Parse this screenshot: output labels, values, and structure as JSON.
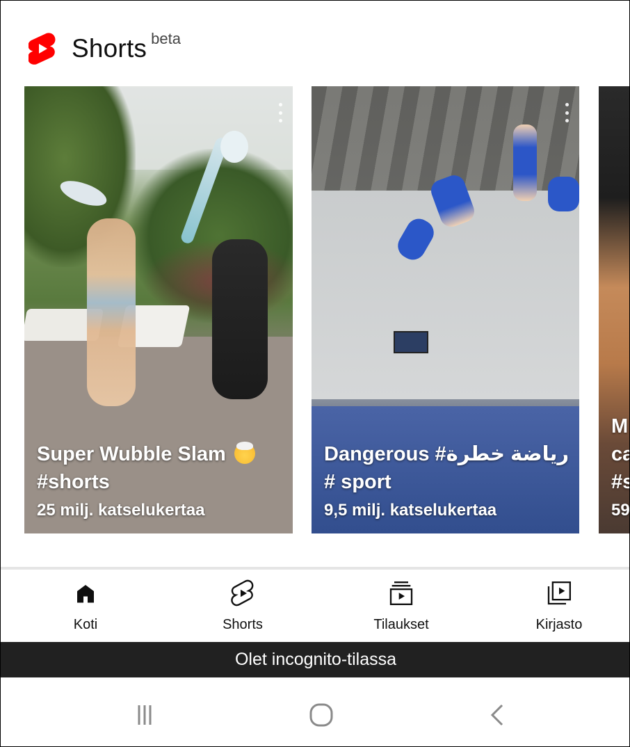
{
  "shelf": {
    "title": "Shorts",
    "badge": "beta",
    "logo_color": "#ff0000"
  },
  "cards": [
    {
      "title": "Super Wubble Slam",
      "title_line2": "#shorts",
      "emoji": "exploding-head",
      "views": "25 milj. katselukertaa"
    },
    {
      "title": "Dangerous #رياضة خطرة",
      "title_line2": "# sport",
      "views": "9,5 milj. katselukertaa"
    },
    {
      "title": "M",
      "title_line2": "ca",
      "title_line3": "#s",
      "views": "59"
    }
  ],
  "nav": {
    "home": "Koti",
    "shorts": "Shorts",
    "subscriptions": "Tilaukset",
    "library": "Kirjasto"
  },
  "incognito": {
    "message": "Olet incognito-tilassa",
    "background": "#212121"
  },
  "icons": {
    "home": "home-icon",
    "shorts": "shorts-icon",
    "subscriptions": "subscriptions-icon",
    "library": "library-icon",
    "recents": "recent-apps-icon",
    "system_home": "system-home-icon",
    "back": "back-icon"
  }
}
